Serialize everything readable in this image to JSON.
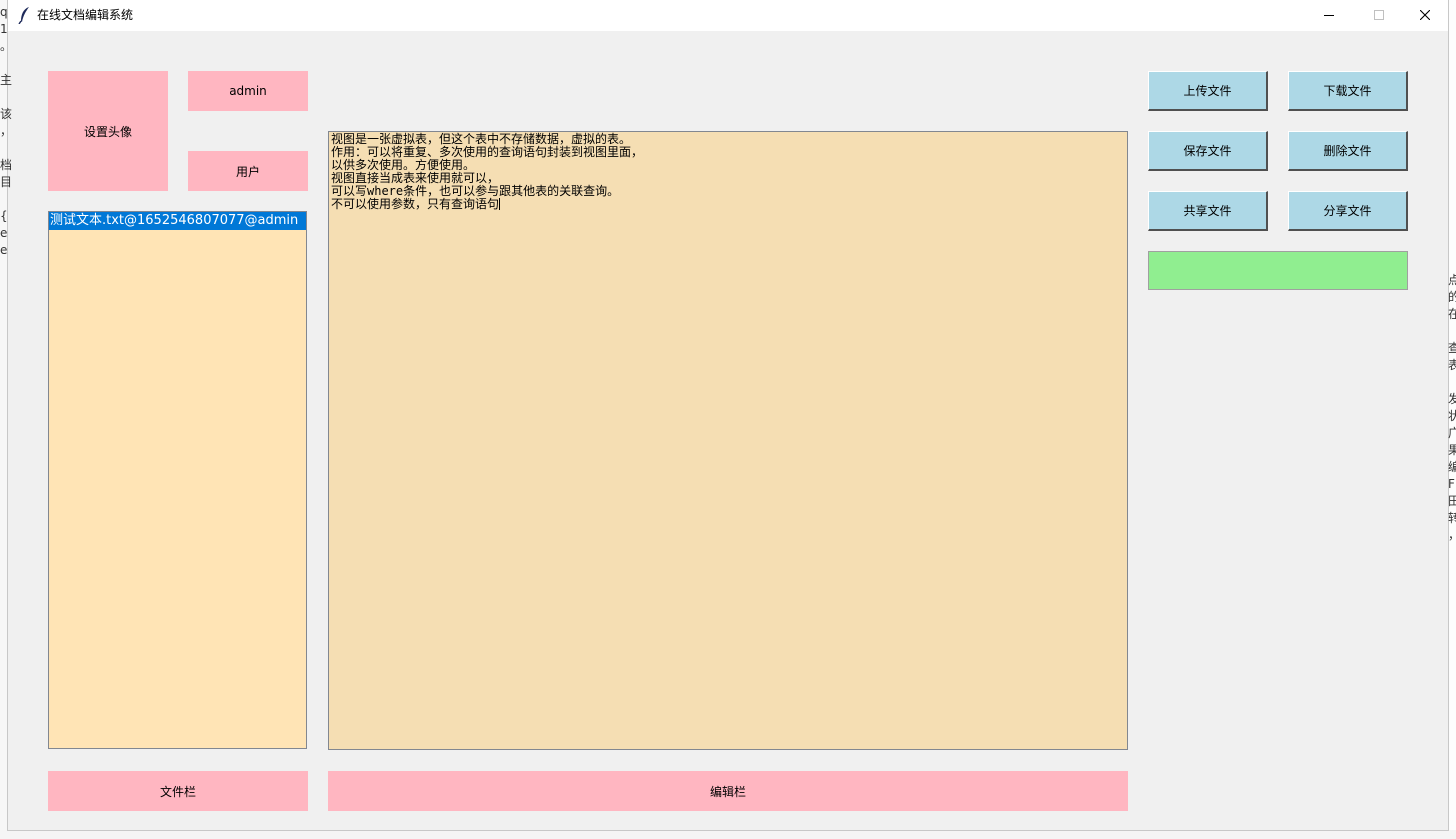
{
  "window": {
    "title": "在线文档编辑系统"
  },
  "profile": {
    "avatar_button": "设置头像",
    "username": "admin",
    "role": "用户"
  },
  "files": {
    "items": [
      "测试文本.txt@1652546807077@admin"
    ],
    "selected_index": 0,
    "label": "文件栏"
  },
  "editor": {
    "lines": [
      "视图是一张虚拟表，但这个表中不存储数据，虚拟的表。",
      "作用：可以将重复、多次使用的查询语句封装到视图里面，",
      "以供多次使用。方便使用。",
      "视图直接当成表来使用就可以，",
      "可以写where条件，也可以参与跟其他表的关联查询。",
      "不可以使用参数，只有查询语句"
    ],
    "label": "编辑栏"
  },
  "actions": {
    "upload": "上传文件",
    "download": "下载文件",
    "save": "保存文件",
    "delete": "删除文件",
    "share_with": "共享文件",
    "share": "分享文件"
  },
  "status": {
    "text": ""
  },
  "background": {
    "left_glyphs": [
      "q",
      "1",
      "。",
      "",
      "主",
      "",
      "该",
      "，",
      "",
      "档",
      "目",
      "",
      "{",
      "e",
      "e"
    ],
    "right_glyphs": [
      "点",
      "的",
      "在",
      "",
      "查",
      "表",
      "",
      "发",
      "状",
      "广",
      "果",
      "编",
      "F",
      "田",
      "转",
      "，"
    ]
  },
  "colors": {
    "pink": "#ffb6c1",
    "light_blue": "#add8e6",
    "list_bg": "#ffe4b5",
    "editor_bg": "#f5deb3",
    "status_green": "#90ee90",
    "selection": "#0078d7"
  }
}
